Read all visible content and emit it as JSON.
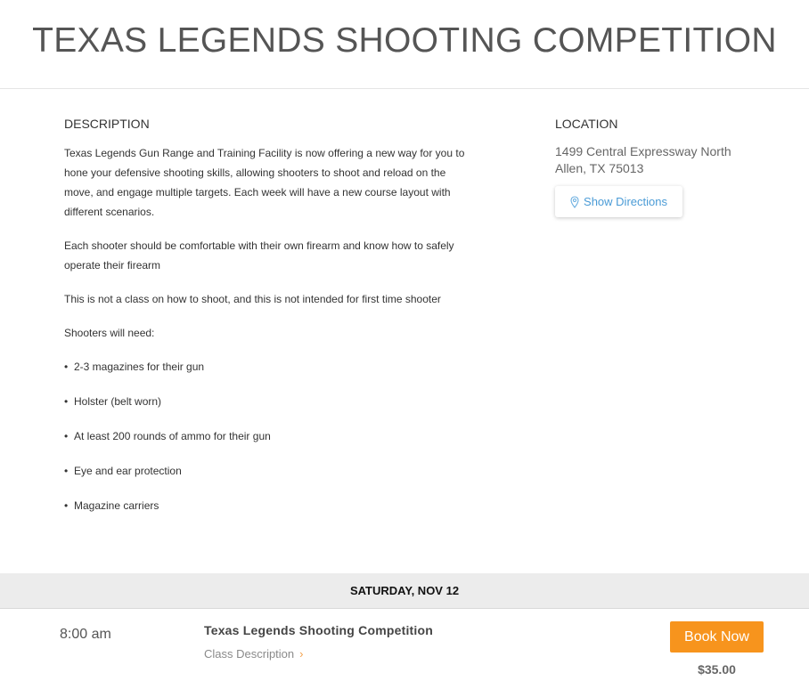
{
  "page": {
    "title": "TEXAS LEGENDS SHOOTING COMPETITION"
  },
  "description": {
    "heading": "DESCRIPTION",
    "paragraphs": [
      "Texas Legends Gun Range and Training Facility is now offering a new way for you to hone your defensive shooting skills, allowing shooters to shoot and reload on the move, and engage multiple targets. Each week will have a new course layout with different scenarios.",
      "Each shooter should be comfortable with their own firearm and know how to safely operate their firearm",
      "This is not a class on how to shoot, and this is not intended for first time shooter",
      "Shooters will need:"
    ],
    "bullet": "•",
    "needs": [
      "2-3 magazines for their gun",
      "Holster (belt worn)",
      "At least 200 rounds of ammo for their gun",
      "Eye and ear protection",
      "Magazine carriers"
    ]
  },
  "location": {
    "heading": "LOCATION",
    "address_line1": "1499 Central Expressway North",
    "address_line2": "Allen, TX 75013",
    "directions_label": "Show Directions",
    "directions_icon": "map-pin-icon"
  },
  "schedule": {
    "date": "SATURDAY, NOV 12",
    "session": {
      "time": "8:00 am",
      "title": "Texas Legends Shooting Competition",
      "class_description_label": "Class Description",
      "chevron": "›",
      "book_label": "Book Now",
      "price": "$35.00"
    }
  },
  "colors": {
    "accent_orange": "#f7941d",
    "link_blue": "#4a9bd6",
    "date_bar_bg": "#ececec"
  }
}
